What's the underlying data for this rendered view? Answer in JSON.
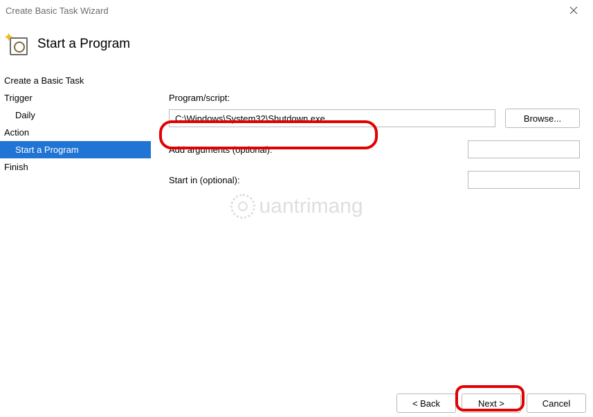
{
  "window": {
    "title": "Create Basic Task Wizard"
  },
  "header": {
    "title": "Start a Program"
  },
  "sidebar": {
    "items": [
      {
        "label": "Create a Basic Task",
        "selected": false,
        "indent": false
      },
      {
        "label": "Trigger",
        "selected": false,
        "indent": false
      },
      {
        "label": "Daily",
        "selected": false,
        "indent": true
      },
      {
        "label": "Action",
        "selected": false,
        "indent": false
      },
      {
        "label": "Start a Program",
        "selected": true,
        "indent": true
      },
      {
        "label": "Finish",
        "selected": false,
        "indent": false
      }
    ]
  },
  "form": {
    "program_label": "Program/script:",
    "program_value": "C:\\Windows\\System32\\Shutdown.exe",
    "browse_label": "Browse...",
    "args_label": "Add arguments (optional):",
    "args_value": "",
    "startin_label": "Start in (optional):",
    "startin_value": ""
  },
  "footer": {
    "back_label": "< Back",
    "next_label": "Next >",
    "cancel_label": "Cancel"
  },
  "watermark": {
    "text": "uantrimang"
  }
}
